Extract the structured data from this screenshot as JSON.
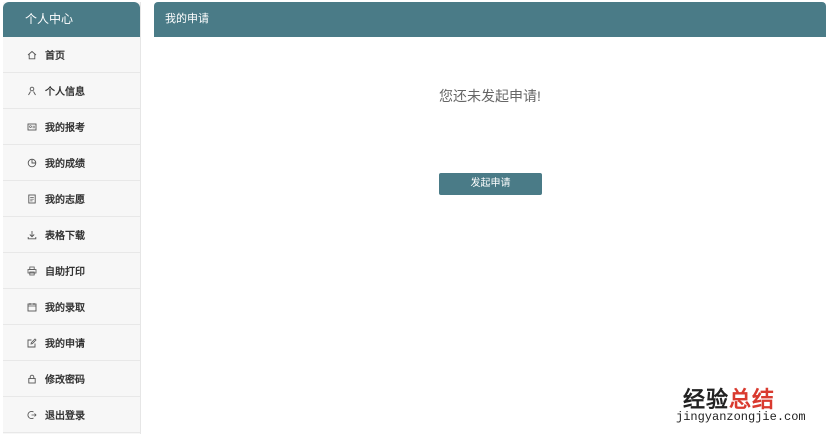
{
  "sidebar": {
    "title": "个人中心",
    "items": [
      {
        "label": "首页",
        "icon": "home-icon"
      },
      {
        "label": "个人信息",
        "icon": "person-icon"
      },
      {
        "label": "我的报考",
        "icon": "id-card-icon"
      },
      {
        "label": "我的成绩",
        "icon": "pie-chart-icon"
      },
      {
        "label": "我的志愿",
        "icon": "document-icon"
      },
      {
        "label": "表格下载",
        "icon": "download-icon"
      },
      {
        "label": "自助打印",
        "icon": "printer-icon"
      },
      {
        "label": "我的录取",
        "icon": "calendar-icon"
      },
      {
        "label": "我的申请",
        "icon": "edit-icon"
      },
      {
        "label": "修改密码",
        "icon": "lock-icon"
      },
      {
        "label": "退出登录",
        "icon": "logout-icon"
      }
    ]
  },
  "main": {
    "header_title": "我的申请",
    "empty_message": "您还未发起申请!",
    "action_button_label": "发起申请"
  },
  "watermark": {
    "title_part1": "经验",
    "title_part2": "总结",
    "url": "jingyanzongjie.com"
  },
  "colors": {
    "primary": "#4a7b87",
    "sidebar_bg": "#f7f7f7",
    "watermark_accent": "#d93a2f"
  }
}
